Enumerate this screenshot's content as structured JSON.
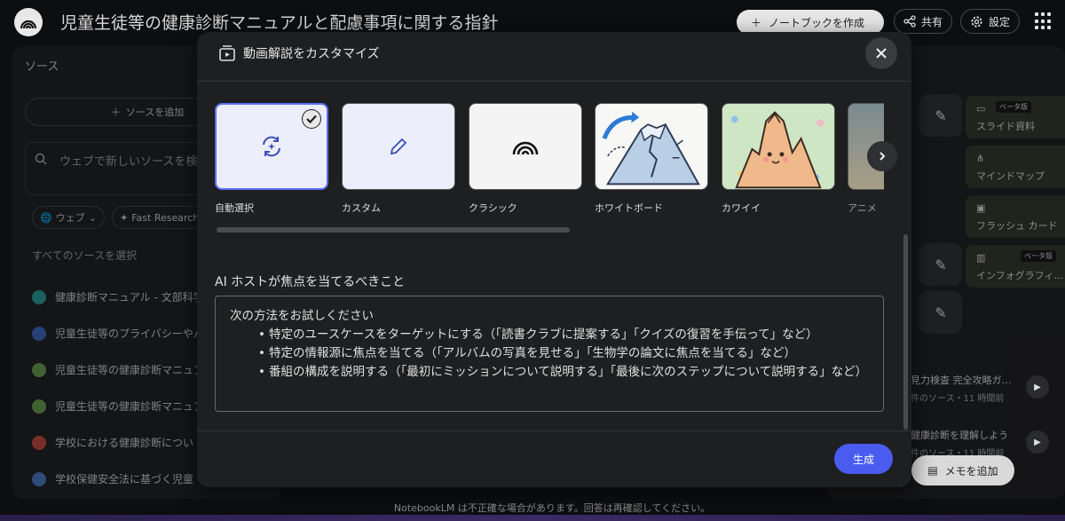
{
  "app": {
    "title": "児童生徒等の健康診断マニュアルと配慮事項に関する指針",
    "create_notebook": "ノートブックを作成",
    "share": "共有",
    "settings": "設定"
  },
  "sources_panel": {
    "title": "ソース",
    "add_source": "ソースを追加",
    "search_placeholder": "ウェブで新しいソースを検",
    "chip_web": "ウェブ",
    "chip_research": "Fast Research",
    "select_all": "すべてのソースを選択",
    "items": [
      {
        "label": "健康診断マニュアル - 文部科学",
        "color": "#2aa6a6"
      },
      {
        "label": "児童生徒等のプライバシーやん",
        "color": "#3a6bc9"
      },
      {
        "label": "児童生徒等の健康診断マニュア",
        "color": "#6aa84f"
      },
      {
        "label": "児童生徒等の健康診断マニュア",
        "color": "#6aa84f"
      },
      {
        "label": "学校における健康診断につい",
        "color": "#d04a3a"
      },
      {
        "label": "学校保健安全法に基づく児童",
        "color": "#4a7bd0"
      }
    ]
  },
  "studio_panel": {
    "cards": [
      {
        "label": "スライド資料",
        "badge": "ベータ版"
      },
      {
        "label": "マインドマップ",
        "badge": ""
      },
      {
        "label": "フラッシュ カード",
        "badge": ""
      },
      {
        "label": "インフォグラフィ…",
        "badge": "ベータ版"
      }
    ],
    "notes": [
      {
        "title": "見力検査 完全攻略ガ…",
        "sub": "件のソース・11 時間前"
      },
      {
        "title": "健康診断を理解しよう",
        "sub": "件のソース・11 時間前"
      }
    ],
    "add_memo": "メモを追加"
  },
  "modal": {
    "title": "動画解説をカスタマイズ",
    "styles": [
      {
        "label": "自動選択",
        "selected": true
      },
      {
        "label": "カスタム",
        "selected": false
      },
      {
        "label": "クラシック",
        "selected": false
      },
      {
        "label": "ホワイトボード",
        "selected": false
      },
      {
        "label": "カワイイ",
        "selected": false
      },
      {
        "label": "アニメ",
        "selected": false
      }
    ],
    "focus_label": "AI ホストが焦点を当てるべきこと",
    "focus_intro": "次の方法をお試しください",
    "focus_bullets": [
      "特定のユースケースをターゲットにする（「読書クラブに提案する」「クイズの復習を手伝って」など）",
      "特定の情報源に焦点を当てる（「アルバムの写真を見せる」「生物学の論文に焦点を当てる」など）",
      "番組の構成を説明する（「最初にミッションについて説明する」「最後に次のステップについて説明する」など）"
    ],
    "generate": "生成"
  },
  "disclaimer": "NotebookLM は不正確な場合があります。回答は再確認してください。",
  "colors": {
    "accent": "#4a5cf0",
    "selected_border": "#5b6ef5",
    "modal_bg": "#1e1f20"
  }
}
